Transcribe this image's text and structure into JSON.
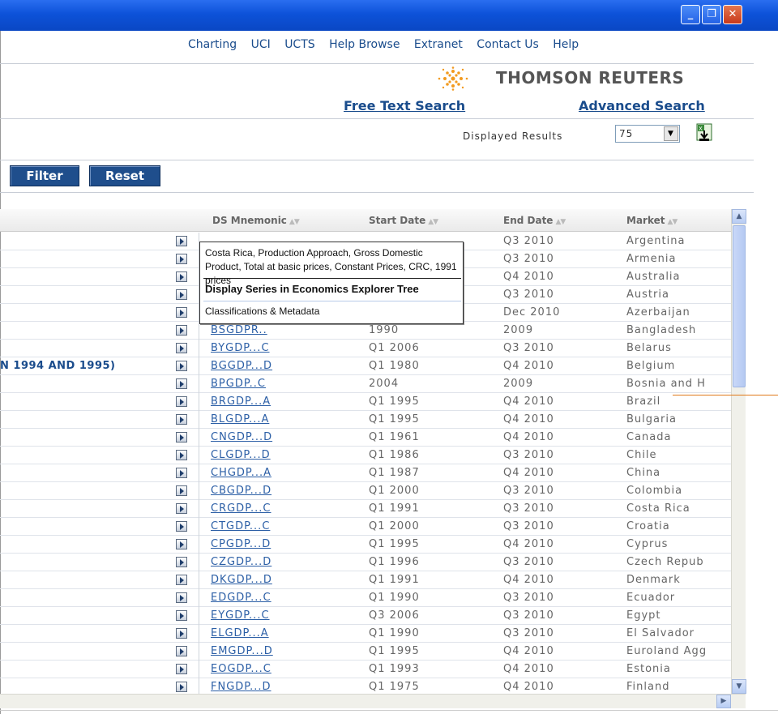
{
  "window": {
    "min_label": "_",
    "max_label": "❐",
    "close_label": "✕"
  },
  "topnav": [
    "Charting",
    "UCI",
    "UCTS",
    "Help Browse",
    "Extranet",
    "Contact Us",
    "Help"
  ],
  "brand": "THOMSON REUTERS",
  "links": {
    "free_text": "Free Text Search",
    "advanced": "Advanced Search"
  },
  "results": {
    "label": "Displayed Results",
    "value": "75"
  },
  "buttons": {
    "filter": "Filter",
    "reset": "Reset"
  },
  "columns": {
    "mnemonic": "DS Mnemonic",
    "start": "Start Date",
    "end": "End Date",
    "market": "Market"
  },
  "rows": [
    {
      "desc": "",
      "mnemonic": "",
      "start": "",
      "end": "Q3 2010",
      "market": "Argentina"
    },
    {
      "desc": "",
      "mnemonic": "",
      "start": "",
      "end": "Q3 2010",
      "market": "Armenia"
    },
    {
      "desc": "",
      "mnemonic": "",
      "start": "",
      "end": "Q4 2010",
      "market": "Australia"
    },
    {
      "desc": "",
      "mnemonic": "",
      "start": "",
      "end": "Q3 2010",
      "market": "Austria"
    },
    {
      "desc": "",
      "mnemonic": "",
      "start": "",
      "end": "Dec 2010",
      "market": "Azerbaijan"
    },
    {
      "desc": "",
      "mnemonic": "BSGDPR..",
      "start": "1990",
      "end": "2009",
      "market": "Bangladesh"
    },
    {
      "desc": "",
      "mnemonic": "BYGDP...C",
      "start": "Q1 2006",
      "end": "Q3 2010",
      "market": "Belarus"
    },
    {
      "desc": "N 1994 AND 1995)",
      "mnemonic": "BGGDP...D",
      "start": "Q1 1980",
      "end": "Q4 2010",
      "market": "Belgium"
    },
    {
      "desc": "",
      "mnemonic": "BPGDP..C",
      "start": "2004",
      "end": "2009",
      "market": "Bosnia and H"
    },
    {
      "desc": "",
      "mnemonic": "BRGDP...A",
      "start": "Q1 1995",
      "end": "Q4 2010",
      "market": "Brazil"
    },
    {
      "desc": "",
      "mnemonic": "BLGDP...A",
      "start": "Q1 1995",
      "end": "Q4 2010",
      "market": "Bulgaria"
    },
    {
      "desc": "",
      "mnemonic": "CNGDP...D",
      "start": "Q1 1961",
      "end": "Q4 2010",
      "market": "Canada"
    },
    {
      "desc": "",
      "mnemonic": "CLGDP...D",
      "start": "Q1 1986",
      "end": "Q3 2010",
      "market": "Chile"
    },
    {
      "desc": "",
      "mnemonic": "CHGDP...A",
      "start": "Q1 1987",
      "end": "Q4 2010",
      "market": "China"
    },
    {
      "desc": "",
      "mnemonic": "CBGDP...D",
      "start": "Q1 2000",
      "end": "Q3 2010",
      "market": "Colombia"
    },
    {
      "desc": "",
      "mnemonic": "CRGDP...C",
      "start": "Q1 1991",
      "end": "Q3 2010",
      "market": "Costa Rica"
    },
    {
      "desc": "",
      "mnemonic": "CTGDP...C",
      "start": "Q1 2000",
      "end": "Q3 2010",
      "market": "Croatia"
    },
    {
      "desc": "",
      "mnemonic": "CPGDP...D",
      "start": "Q1 1995",
      "end": "Q4 2010",
      "market": "Cyprus"
    },
    {
      "desc": "",
      "mnemonic": "CZGDP...D",
      "start": "Q1 1996",
      "end": "Q3 2010",
      "market": "Czech Repub"
    },
    {
      "desc": "",
      "mnemonic": "DKGDP...D",
      "start": "Q1 1991",
      "end": "Q4 2010",
      "market": "Denmark"
    },
    {
      "desc": "",
      "mnemonic": "EDGDP...C",
      "start": "Q1 1990",
      "end": "Q3 2010",
      "market": "Ecuador"
    },
    {
      "desc": "",
      "mnemonic": "EYGDP...C",
      "start": "Q3 2006",
      "end": "Q3 2010",
      "market": "Egypt"
    },
    {
      "desc": "",
      "mnemonic": "ELGDP...A",
      "start": "Q1 1990",
      "end": "Q3 2010",
      "market": "El Salvador"
    },
    {
      "desc": "",
      "mnemonic": "EMGDP...D",
      "start": "Q1 1995",
      "end": "Q4 2010",
      "market": "Euroland Agg"
    },
    {
      "desc": "",
      "mnemonic": "EOGDP...C",
      "start": "Q1 1993",
      "end": "Q4 2010",
      "market": "Estonia"
    },
    {
      "desc": "",
      "mnemonic": "FNGDP...D",
      "start": "Q1 1975",
      "end": "Q4 2010",
      "market": "Finland"
    }
  ],
  "tooltip": {
    "description": "Costa Rica, Production Approach, Gross Domestic Product, Total at basic prices, Constant Prices, CRC, 1991 prices",
    "action": "Display Series in Economics Explorer Tree",
    "meta": "Classifications & Metadata"
  }
}
